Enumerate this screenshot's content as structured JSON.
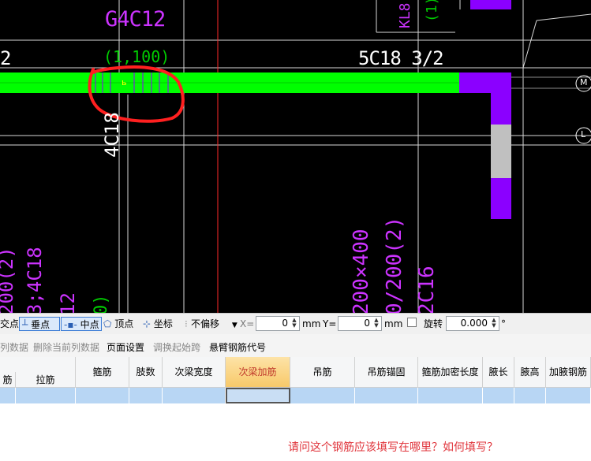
{
  "cad": {
    "labels": {
      "g4c12": "G4C12",
      "span_1100": "(1,100)",
      "five_c18": "5C18 3/2",
      "four_c18": "4C18",
      "kl8": "KL8",
      "kl8_num": "(1)(",
      "left_2": "2",
      "bottom_200x400": "200×400",
      "bottom_0_200": "0/200(2)",
      "bottom_2c16": "2C16",
      "bottom_left_200_2": "200(2)",
      "bottom_left_3_4c18": "3;4C18",
      "bottom_12": "12",
      "bottom_0": "0)",
      "marker_m": "M",
      "marker_l": "L"
    },
    "colors": {
      "beam": "#00ff00",
      "column": "#8b00ff",
      "text": "#cc33ff",
      "white_text": "#ffffff",
      "red_mark": "#ff2020",
      "grid": "#e0e0e0"
    }
  },
  "snapbar": {
    "jiaodian": "交点",
    "chuidian": "垂点",
    "zhongdian": "中点",
    "dingdian": "顶点",
    "zuobiao": "坐标",
    "offset_select": "不偏移",
    "x_label": "X=",
    "x_value": "0",
    "x_unit": "mm",
    "y_label": "Y=",
    "y_value": "0",
    "y_unit": "mm",
    "rotate_label": "旋转",
    "rotate_value": "0.000",
    "degree": "°"
  },
  "toolbar2": {
    "col_data": "列数据",
    "delete_col": "删除当前列数据",
    "page_setup": "页面设置",
    "adjust_start": "调换起始跨",
    "cantilever": "悬臂钢筋代号"
  },
  "grid": {
    "headers": {
      "jin": "筋",
      "lajin": "拉筋",
      "gujin": "箍筋",
      "zhishu": "肢数",
      "ciliang_kuan": "次梁宽度",
      "ciliang_jia": "次梁加筋",
      "diaojin": "吊筋",
      "diaojin_mg": "吊筋锚固",
      "gujin_jm": "箍筋加密长度",
      "yechang": "腋长",
      "yegao": "腋高",
      "jiayegang": "加腋钢筋"
    }
  },
  "question": "请问这个钢筋应该填写在哪里？如何填写？"
}
